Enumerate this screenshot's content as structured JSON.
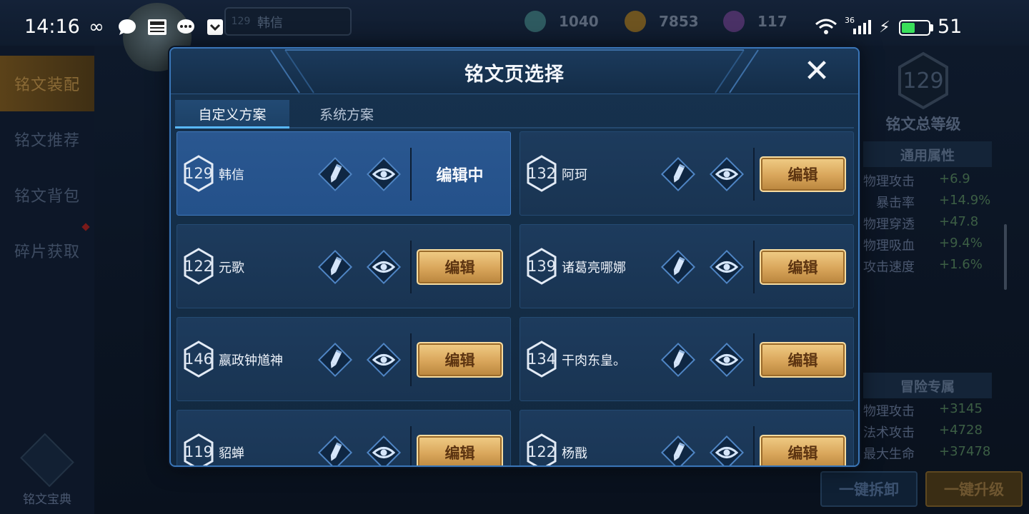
{
  "status_bar": {
    "time": "14:16",
    "network_type": "36",
    "battery_level": "51",
    "battery_fraction": 0.51,
    "icons": [
      "infinity-icon",
      "chat-icon",
      "news-icon",
      "message-icon",
      "inbox-icon",
      "wifi-icon",
      "signal-icon",
      "charging-icon",
      "battery-icon"
    ]
  },
  "top_bar": {
    "level": "129",
    "player_name": "韩信",
    "resources": [
      {
        "icon": "diamond-gem-icon",
        "color": "#3a6e72",
        "value": "1040"
      },
      {
        "icon": "gold-coin-icon",
        "color": "#8a6a22",
        "value": "7853"
      },
      {
        "icon": "purple-crystal-icon",
        "color": "#5b3a7a",
        "value": "117"
      }
    ]
  },
  "left_nav": {
    "items": [
      {
        "label": "铭文装配",
        "active": true
      },
      {
        "label": "铭文推荐",
        "active": false
      },
      {
        "label": "铭文背包",
        "active": false
      },
      {
        "label": "碎片获取",
        "active": false
      }
    ],
    "codex_label": "铭文宝典"
  },
  "right_panel": {
    "total_level": "129",
    "total_level_label": "铭文总等级",
    "general_title": "通用属性",
    "general_stats": [
      {
        "name": "物理攻击",
        "value": "+6.9"
      },
      {
        "name": "暴击率",
        "value": "+14.9%"
      },
      {
        "name": "物理穿透",
        "value": "+47.8"
      },
      {
        "name": "物理吸血",
        "value": "+9.4%"
      },
      {
        "name": "攻击速度",
        "value": "+1.6%"
      }
    ],
    "adventure_title": "冒险专属",
    "adventure_stats": [
      {
        "name": "物理攻击",
        "value": "+3145"
      },
      {
        "name": "法术攻击",
        "value": "+4728"
      },
      {
        "name": "最大生命",
        "value": "+37478"
      }
    ],
    "unload_label": "一键拆卸",
    "upgrade_label": "一键升级"
  },
  "dialog": {
    "title": "铭文页选择",
    "close_glyph": "✕",
    "tabs": [
      {
        "label": "自定义方案",
        "active": true
      },
      {
        "label": "系统方案",
        "active": false
      }
    ],
    "edit_label": "编辑",
    "editing_label": "编辑中",
    "pages": [
      {
        "level": "129",
        "name": "韩信",
        "selected": true
      },
      {
        "level": "132",
        "name": "阿珂",
        "selected": false
      },
      {
        "level": "122",
        "name": "元歌",
        "selected": false
      },
      {
        "level": "139",
        "name": "诸葛亮哪娜",
        "selected": false
      },
      {
        "level": "146",
        "name": "嬴政钟馗神",
        "selected": false
      },
      {
        "level": "134",
        "name": "干肉东皇。",
        "selected": false
      },
      {
        "level": "119",
        "name": "貂蝉",
        "selected": false
      },
      {
        "level": "122",
        "name": "杨戬",
        "selected": false
      }
    ]
  },
  "colors": {
    "accent_blue": "#3a76b8",
    "selected_card": "#2a5790",
    "edit_button_gold": "#d8a55a",
    "positive_stat": "#3c5e44"
  }
}
